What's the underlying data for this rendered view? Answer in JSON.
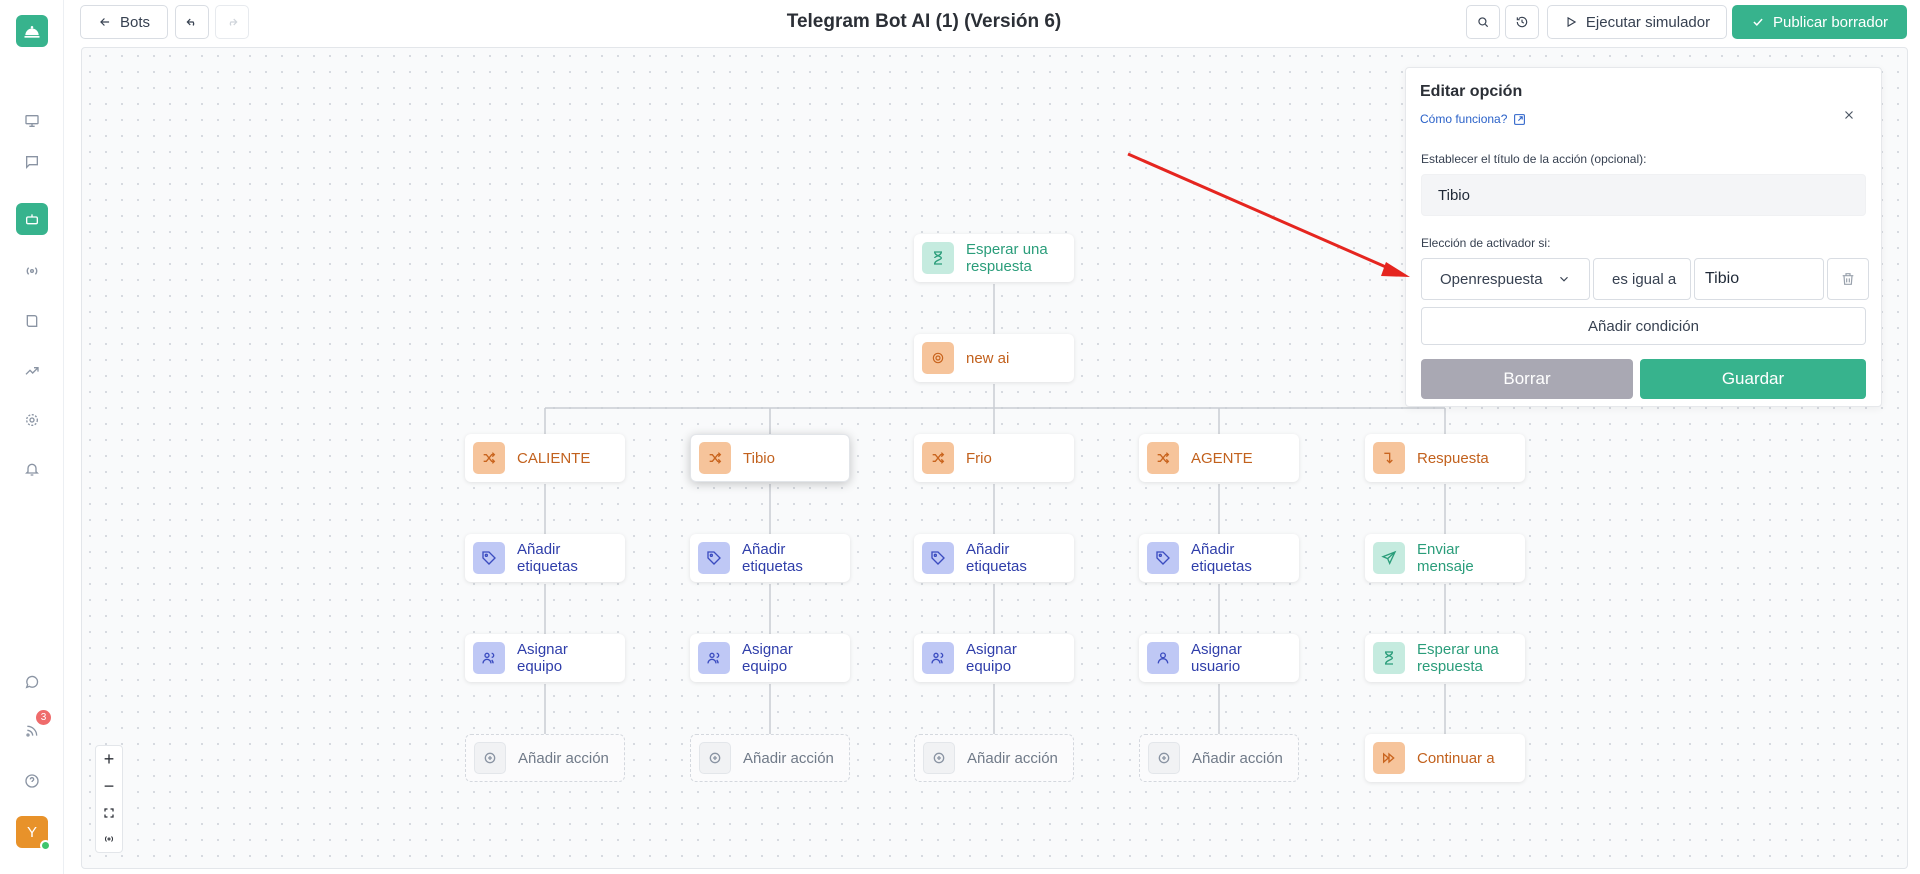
{
  "app": {
    "title": "Telegram Bot AI (1) (Versión 6)",
    "accent_color": "#37b38d"
  },
  "sidebar": {
    "items": [
      {
        "icon": "monitor-icon"
      },
      {
        "icon": "chat-icon"
      },
      {
        "icon": "bot-icon",
        "active": true
      },
      {
        "icon": "broadcast-icon"
      },
      {
        "icon": "book-icon"
      },
      {
        "icon": "trend-icon"
      },
      {
        "icon": "gear-icon"
      },
      {
        "icon": "bell-icon"
      }
    ],
    "bottom": [
      {
        "icon": "whatsapp-icon"
      },
      {
        "icon": "rss-icon",
        "badge": "3"
      },
      {
        "icon": "help-icon"
      }
    ],
    "avatar_initial": "Y"
  },
  "toolbar": {
    "back_label": "Bots",
    "simulate_label": "Ejecutar simulador",
    "publish_label": "Publicar borrador"
  },
  "flow": {
    "wait_top": "Esperar una respuesta",
    "ai_node": "new ai",
    "branches": [
      {
        "trigger": "CALIENTE",
        "tags": "Añadir etiquetas",
        "assign": "Asignar equipo",
        "add": "Añadir acción"
      },
      {
        "trigger": "Tibio",
        "tags": "Añadir etiquetas",
        "assign": "Asignar equipo",
        "add": "Añadir acción"
      },
      {
        "trigger": "Frio",
        "tags": "Añadir etiquetas",
        "assign": "Asignar equipo",
        "add": "Añadir acción"
      },
      {
        "trigger": "AGENTE",
        "tags": "Añadir etiquetas",
        "assign": "Asignar usuario",
        "add": "Añadir acción"
      },
      {
        "trigger": "Respuesta",
        "tags": "Enviar mensaje",
        "assign": "Esperar una respuesta",
        "add": "Continuar a"
      }
    ]
  },
  "panel": {
    "title": "Editar opción",
    "help_link": "Cómo funciona?",
    "title_label": "Establecer el título de la acción (opcional):",
    "title_value": "Tibio",
    "trigger_label": "Elección de activador si:",
    "condition_field": "Openrespuesta",
    "condition_operator": "es igual a",
    "condition_value": "Tibio",
    "add_condition": "Añadir condición",
    "delete_label": "Borrar",
    "save_label": "Guardar"
  }
}
